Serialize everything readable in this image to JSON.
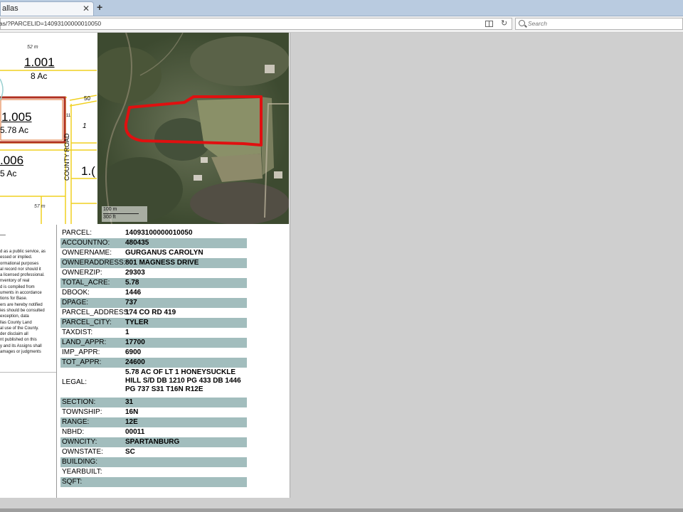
{
  "browser": {
    "tab_title": "allas",
    "url": "las/?PARCELID=14093100000010050",
    "search_placeholder": "Search"
  },
  "parcel_map": {
    "labels": [
      {
        "name": "parcel-number",
        "text": "1.001"
      },
      {
        "name": "parcel-acreage",
        "text": "8 Ac"
      },
      {
        "name": "parcel-number",
        "text": "1.005"
      },
      {
        "name": "parcel-acreage",
        "text": "5.78 Ac"
      },
      {
        "name": "parcel-number",
        "text": ".006"
      },
      {
        "name": "parcel-acreage",
        "text": "5 Ac"
      },
      {
        "name": "parcel-number",
        "text": "1.("
      },
      {
        "name": "parcel-number",
        "text": "1"
      },
      {
        "name": "road-label",
        "text": "COUNTY ROAD"
      },
      {
        "name": "road-label",
        "text": "50"
      },
      {
        "name": "road-label",
        "text": "11"
      },
      {
        "name": "measurement",
        "text": "52 m"
      },
      {
        "name": "measurement",
        "text": "57 m"
      }
    ]
  },
  "aerial": {
    "scale_m": "100 m",
    "scale_ft": "300 ft",
    "boundary_color": "#e01010"
  },
  "disclaimer": {
    "title": "_",
    "lines": [
      "d as a public service, as",
      "essed or implied.",
      "ormational purposes",
      "al record nor should it",
      "a licensed professional.",
      "nventory of real",
      "d is compiled from",
      "uments in accordance",
      "tions for Base.",
      "ers are hereby notified",
      "ies should be consulted",
      "exception, data",
      "llas County Land",
      "al use of the County.",
      "der disclaim all",
      "nt published on this",
      "y and its Assigns shall",
      "amages or judgments"
    ]
  },
  "attributes": [
    {
      "key": "PARCEL:",
      "value": "14093100000010050",
      "shaded": false
    },
    {
      "key": "ACCOUNTNO:",
      "value": "480435",
      "shaded": true
    },
    {
      "key": "OWNERNAME:",
      "value": "GURGANUS CAROLYN",
      "shaded": false
    },
    {
      "key": "OWNERADDRESS:",
      "value": "801 MAGNESS DRIVE",
      "shaded": true
    },
    {
      "key": "OWNERZIP:",
      "value": "29303",
      "shaded": false
    },
    {
      "key": "TOTAL_ACRE:",
      "value": "5.78",
      "shaded": true
    },
    {
      "key": "DBOOK:",
      "value": "1446",
      "shaded": false
    },
    {
      "key": "DPAGE:",
      "value": "737",
      "shaded": true
    },
    {
      "key": "PARCEL_ADDRESS:",
      "value": "174 CO RD 419",
      "shaded": false
    },
    {
      "key": "PARCEL_CITY:",
      "value": "TYLER",
      "shaded": true
    },
    {
      "key": "TAXDIST:",
      "value": "1",
      "shaded": false
    },
    {
      "key": "LAND_APPR:",
      "value": "17700",
      "shaded": true
    },
    {
      "key": "IMP_APPR:",
      "value": "6900",
      "shaded": false
    },
    {
      "key": "TOT_APPR:",
      "value": "24600",
      "shaded": true
    },
    {
      "key": "LEGAL:",
      "value": "5.78 AC OF LT 1 HONEYSUCKLE HILL S/D DB 1210 PG 433 DB 1446 PG 737 S31 T16N R12E",
      "shaded": false,
      "legal": true
    },
    {
      "key": "SECTION:",
      "value": "31",
      "shaded": true
    },
    {
      "key": "TOWNSHIP:",
      "value": "16N",
      "shaded": false
    },
    {
      "key": "RANGE:",
      "value": "12E",
      "shaded": true
    },
    {
      "key": "NBHD:",
      "value": "00011",
      "shaded": false
    },
    {
      "key": "OWNCITY:",
      "value": "SPARTANBURG",
      "shaded": true
    },
    {
      "key": "OWNSTATE:",
      "value": "SC",
      "shaded": false
    },
    {
      "key": "BUILDING:",
      "value": "",
      "shaded": true
    },
    {
      "key": "YEARBUILT:",
      "value": "",
      "shaded": false
    },
    {
      "key": "SQFT:",
      "value": "",
      "shaded": true
    }
  ]
}
